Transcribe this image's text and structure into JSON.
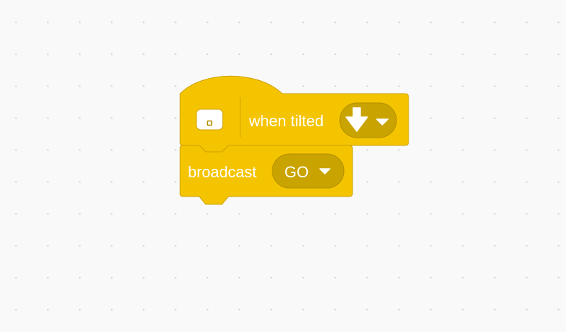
{
  "colors": {
    "background": "#f9f9f9",
    "grid_dot": "#d6d6d6",
    "block_fill": "#f5c400",
    "block_stroke": "#cca100",
    "dropdown_fill": "#c9a400",
    "dropdown_stroke": "#b08f00",
    "text": "#ffffff"
  },
  "hat_block": {
    "category_icon": "hub-device-icon",
    "label": "when tilted",
    "dropdown": {
      "selected_icon": "tilt-down-arrow-icon",
      "caret_icon": "dropdown-caret-icon"
    }
  },
  "stack_block": {
    "label": "broadcast",
    "dropdown": {
      "selected": "GO",
      "caret_icon": "dropdown-caret-icon"
    }
  }
}
